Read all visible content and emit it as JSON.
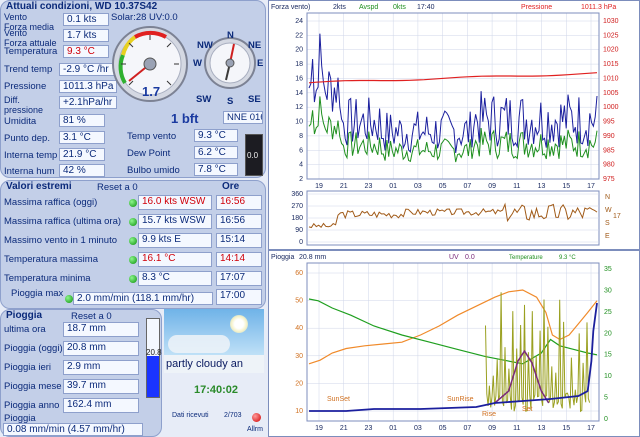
{
  "current": {
    "title": "Attuali condizioni, WD 10.37S42",
    "wind_avg_label": "Vento\nForza media",
    "wind_avg_value": "0.1 kts",
    "solar_uv": "Solar:28 UV:0.0",
    "wind_now_label": "Vento\nForza attuale",
    "wind_now_value": "1.7 kts",
    "temp_label": "Temperatura",
    "temp_value": "9.3 °C",
    "trend_temp_label": "Trend temp",
    "trend_temp_value": "-2.9 °C /hr",
    "pressure_label": "Pressione",
    "pressure_value": "1011.3 hPa",
    "diff_pressure_label": "Diff.\npressione",
    "diff_pressure_value": "+2.1hPa/hr",
    "humidity_label": "Umidita",
    "humidity_value": "81 %",
    "dew_label": "Punto dep.",
    "dew_value": "3.1 °C",
    "int_temp_label": "Interna temp",
    "int_temp_value": "21.9 °C",
    "int_hum_label": "Interna hum",
    "int_hum_value": "42 %",
    "gauge_value": "1.7",
    "bft": "1 bft",
    "direction": "NNE 016 °",
    "windchill_label": "Temp vento",
    "windchill_value": "9.3 °C",
    "dewpoint_label": "Dew Point",
    "dewpoint_value": "6.2 °C",
    "wetbulb_label": "Bulbo umido",
    "wetbulb_value": "7.8 °C",
    "small_box": "0.0",
    "compass": {
      "N": "N",
      "NE": "NE",
      "E": "E",
      "SE": "SE",
      "S": "S",
      "SW": "SW",
      "W": "W",
      "NW": "NW"
    }
  },
  "extremes": {
    "title": "Valori estremi",
    "reset_label": "Reset a 0",
    "time_header": "Ore",
    "rows": [
      {
        "label": "Massima raffica (oggi)",
        "value": "16.0 kts WSW",
        "red": true,
        "time": "16:56",
        "time_red": true
      },
      {
        "label": "Massima raffica (ultima ora)",
        "value": "15.7 kts WSW",
        "red": false,
        "time": "16:56",
        "time_red": false
      },
      {
        "label": "Massimo vento in 1 minuto",
        "value": "9.9 kts   E",
        "red": false,
        "time": "15:14",
        "time_red": false
      },
      {
        "label": "Temperatura massima",
        "value": "16.1 °C",
        "red": true,
        "time": "14:14",
        "time_red": true
      },
      {
        "label": "Temperatura minima",
        "value": "8.3 °C",
        "red": false,
        "time": "17:07",
        "time_red": false
      }
    ],
    "rain_max_label": "Pioggia max",
    "rain_max_value": "2.0 mm/min (118.1 mm/hr)",
    "rain_max_time": "17:00"
  },
  "rain": {
    "title": "Pioggia",
    "reset_label": "Reset a 0",
    "rows": [
      {
        "label": "ultima ora",
        "value": "18.7 mm"
      },
      {
        "label": "Pioggia (oggi)",
        "value": "20.8 mm"
      },
      {
        "label": "Pioggia ieri",
        "value": "2.9 mm"
      },
      {
        "label": "Pioggia mese",
        "value": "39.7 mm"
      },
      {
        "label": "Pioggia anno",
        "value": "162.4 mm"
      }
    ],
    "rate_label": "Pioggia",
    "rate_value": "0.08 mm/min (4.57 mm/hr)",
    "tube_value": "20.8",
    "tube_fill_fraction": 0.52
  },
  "weather": {
    "caption": "partly cloudy an",
    "time": "17:40:02",
    "data_label": "Dati ricevuti",
    "count": "2/703",
    "alarm_label": "Allrm"
  },
  "wind_chart": {
    "title": "Forza vento)",
    "legend_wind": "2kts",
    "legend_avg_label": "Avspd",
    "legend_avg_value": "0kts",
    "legend_time": "17:40",
    "legend_pressure": "Pressione",
    "legend_pressure_value": "1011.3 hPa",
    "y_left": [
      "24",
      "22",
      "20",
      "18",
      "16",
      "14",
      "12",
      "10",
      "8",
      "6",
      "4",
      "2"
    ],
    "y_right": [
      "1030",
      "1025",
      "1020",
      "1015",
      "1010",
      "1005",
      "1000",
      "995",
      "990",
      "985",
      "980",
      "975"
    ],
    "x_ticks": [
      "19",
      "21",
      "23",
      "01",
      "03",
      "05",
      "07",
      "09",
      "11",
      "13",
      "15",
      "17"
    ],
    "dir_ticks": [
      "360",
      "270",
      "180",
      "90",
      "0"
    ],
    "dir_side": [
      "N",
      "W",
      "S",
      "E"
    ],
    "dir_side_value": "17",
    "colors": {
      "wind": "#1b1f9e",
      "avg": "#1f8f1f",
      "pressure": "#e02020",
      "dir": "#a05a18"
    }
  },
  "rain_chart": {
    "title": "Pioggia",
    "title_value": "20.8 mm",
    "legend_uv": "UV",
    "legend_uv_value": "0.0",
    "legend_temp": "Temperature",
    "legend_temp_value": "9.3 °C",
    "y_left": [
      "60",
      "50",
      "40",
      "30",
      "20",
      "10"
    ],
    "y_right": [
      "35",
      "30",
      "25",
      "20",
      "15",
      "10",
      "5",
      "0"
    ],
    "x_ticks": [
      "19",
      "21",
      "23",
      "01",
      "03",
      "05",
      "07",
      "09",
      "11",
      "13",
      "15",
      "17"
    ],
    "annotations": [
      "SunSet",
      "SunRise",
      "Rise",
      "Set"
    ],
    "colors": {
      "rain": "#1b1f9e",
      "temp": "#f08a2a",
      "humidity": "#1f9f1f",
      "uv": "#9aa020",
      "solar": "#7a2a7a"
    }
  }
}
